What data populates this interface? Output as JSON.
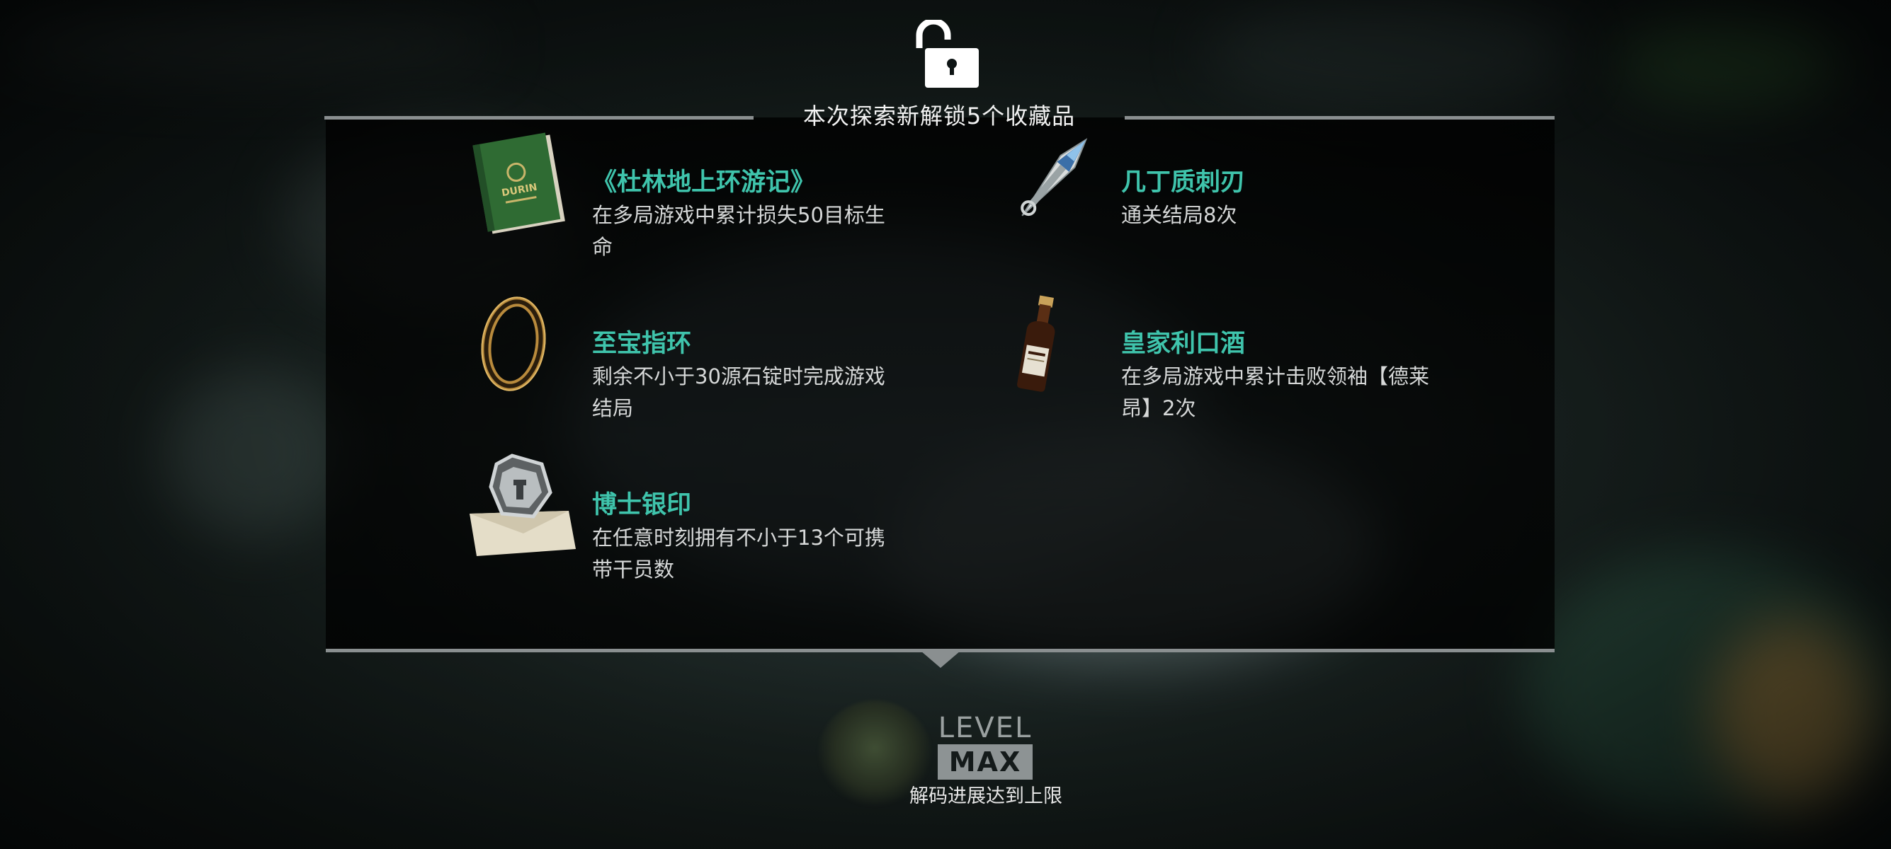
{
  "popup": {
    "title": "本次探索新解锁5个收藏品",
    "icon": "unlock-icon"
  },
  "items": [
    {
      "name": "《杜林地上环游记》",
      "desc": "在多局游戏中累计损失50目标生命",
      "icon": "book-icon",
      "icon_text": "DURIN"
    },
    {
      "name": "几丁质刺刃",
      "desc": "通关结局8次",
      "icon": "blade-icon"
    },
    {
      "name": "至宝指环",
      "desc": "剩余不小于30源石锭时完成游戏结局",
      "icon": "ring-icon"
    },
    {
      "name": "皇家利口酒",
      "desc": "在多局游戏中累计击败领袖【德莱昂】2次",
      "icon": "bottle-icon"
    },
    {
      "name": "博士银印",
      "desc": "在任意时刻拥有不小于13个可携带干员数",
      "icon": "seal-icon"
    }
  ],
  "level": {
    "word": "LEVEL",
    "badge": "MAX",
    "caption": "解码进展达到上限"
  },
  "colors": {
    "accent": "#3fc4ac",
    "rule": "#8a8f90",
    "text": "#f2f2f2"
  }
}
